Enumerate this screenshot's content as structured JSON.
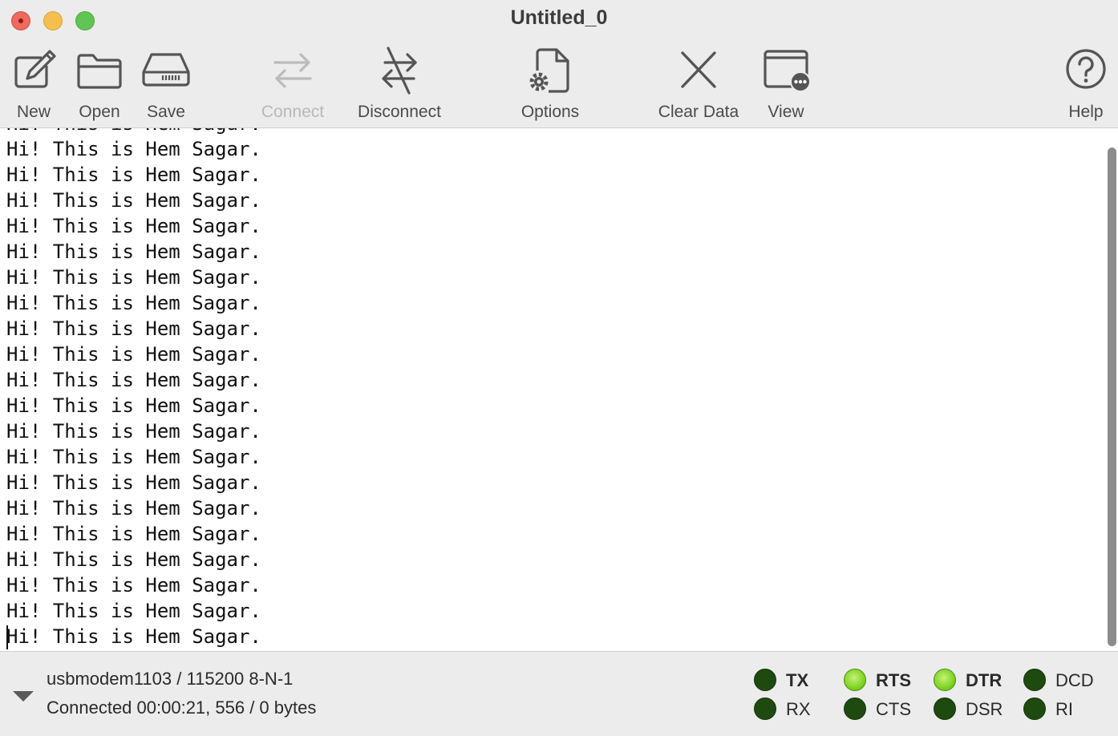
{
  "window": {
    "title": "Untitled_0"
  },
  "toolbar": {
    "new": {
      "label": "New",
      "icon": "compose-icon"
    },
    "open": {
      "label": "Open",
      "icon": "folder-icon"
    },
    "save": {
      "label": "Save",
      "icon": "drive-icon"
    },
    "connect": {
      "label": "Connect",
      "icon": "arrows-swap-icon",
      "enabled": false
    },
    "disconnect": {
      "label": "Disconnect",
      "icon": "arrows-swap-slash-icon"
    },
    "options": {
      "label": "Options",
      "icon": "document-gear-icon"
    },
    "clear": {
      "label": "Clear Data",
      "icon": "x-icon"
    },
    "view": {
      "label": "View",
      "icon": "window-more-icon"
    },
    "help": {
      "label": "Help",
      "icon": "question-circle-icon"
    }
  },
  "terminal": {
    "lines": [
      "Hi! This is Hem Sagar.",
      "Hi! This is Hem Sagar.",
      "Hi! This is Hem Sagar.",
      "Hi! This is Hem Sagar.",
      "Hi! This is Hem Sagar.",
      "Hi! This is Hem Sagar.",
      "Hi! This is Hem Sagar.",
      "Hi! This is Hem Sagar.",
      "Hi! This is Hem Sagar.",
      "Hi! This is Hem Sagar.",
      "Hi! This is Hem Sagar.",
      "Hi! This is Hem Sagar.",
      "Hi! This is Hem Sagar.",
      "Hi! This is Hem Sagar.",
      "Hi! This is Hem Sagar.",
      "Hi! This is Hem Sagar.",
      "Hi! This is Hem Sagar.",
      "Hi! This is Hem Sagar.",
      "Hi! This is Hem Sagar.",
      "Hi! This is Hem Sagar.",
      "Hi! This is Hem Sagar."
    ]
  },
  "status": {
    "port": "usbmodem1103 / 115200 8-N-1",
    "connection": "Connected 00:00:21, 556 / 0 bytes"
  },
  "signals": {
    "tx": {
      "label": "TX",
      "on": false
    },
    "rx": {
      "label": "RX",
      "on": false
    },
    "rts": {
      "label": "RTS",
      "on": true
    },
    "cts": {
      "label": "CTS",
      "on": false
    },
    "dtr": {
      "label": "DTR",
      "on": true
    },
    "dsr": {
      "label": "DSR",
      "on": false
    },
    "dcd": {
      "label": "DCD",
      "on": false
    },
    "ri": {
      "label": "RI",
      "on": false
    }
  },
  "colors": {
    "led_on": "#7ed321",
    "led_off": "#1e4a10",
    "close": "#ed6a5e",
    "minimize": "#f5bf4f",
    "maximize": "#61c554"
  }
}
